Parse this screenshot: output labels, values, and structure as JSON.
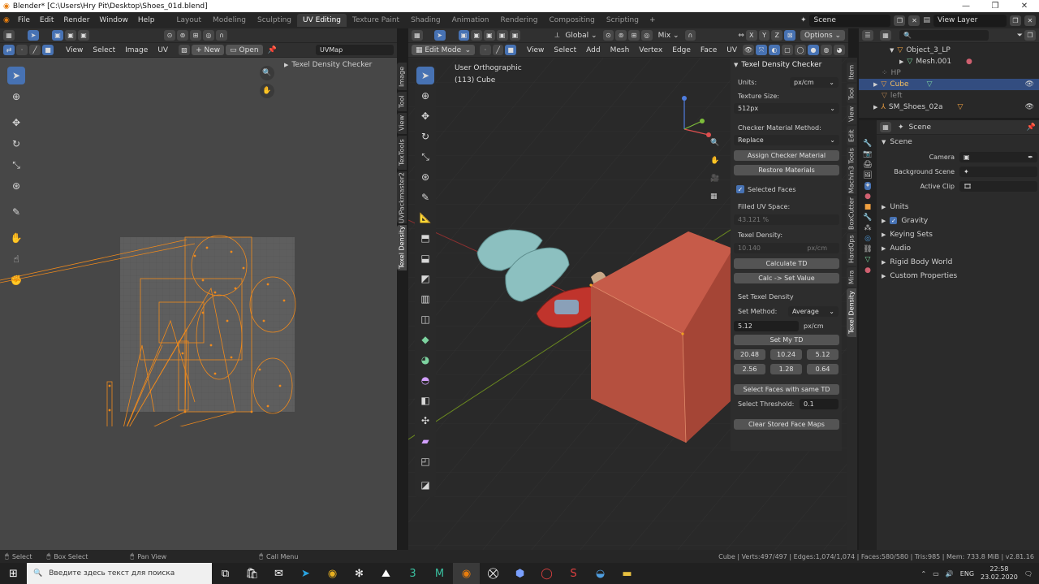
{
  "window": {
    "title": "Blender* [C:\\Users\\Hry Pit\\Desktop\\Shoes_01d.blend]"
  },
  "menu": [
    "File",
    "Edit",
    "Render",
    "Window",
    "Help"
  ],
  "workspaces": [
    "Layout",
    "Modeling",
    "Sculpting",
    "UV Editing",
    "Texture Paint",
    "Shading",
    "Animation",
    "Rendering",
    "Compositing",
    "Scripting"
  ],
  "active_workspace": "UV Editing",
  "scene_name": "Scene",
  "view_layer": "View Layer",
  "uv_editor": {
    "menus": [
      "View",
      "Select",
      "Image",
      "UV"
    ],
    "new_label": "New",
    "open_label": "Open",
    "uvmap": "UVMap",
    "sidebar_title": "Texel Density Checker",
    "tabs": [
      "Image",
      "Tool",
      "View",
      "TexTools",
      "UVPackmaster2",
      "Texel Density"
    ]
  },
  "viewport": {
    "mode": "Edit Mode",
    "menus": [
      "View",
      "Select",
      "Add",
      "Mesh",
      "Vertex",
      "Edge",
      "Face",
      "UV"
    ],
    "transform": "Global",
    "proportional": "Mix",
    "axes": [
      "X",
      "Y",
      "Z"
    ],
    "options_label": "Options",
    "view_name": "User Orthographic",
    "object_info": "(113) Cube",
    "tabs": [
      "Item",
      "Tool",
      "View",
      "Edit",
      "Machin3 Tools",
      "BoxCutter",
      "HardOps",
      "Mira",
      "Texel Density"
    ]
  },
  "td_panel": {
    "title": "Texel Density Checker",
    "units_label": "Units:",
    "units_value": "px/cm",
    "texture_size_label": "Texture Size:",
    "texture_size_value": "512px",
    "checker_method_label": "Checker Material Method:",
    "checker_method_value": "Replace",
    "assign_btn": "Assign Checker Material",
    "restore_btn": "Restore Materials",
    "selected_faces_label": "Selected Faces",
    "selected_faces_checked": true,
    "filled_uv_label": "Filled UV Space:",
    "filled_uv_value": "43.121 %",
    "texel_density_label": "Texel Density:",
    "texel_density_value": "10.140",
    "texel_density_unit": "px/cm",
    "calc_btn": "Calculate TD",
    "calc_set_btn": "Calc -> Set Value",
    "set_td_title": "Set Texel Density",
    "set_method_label": "Set Method:",
    "set_method_value": "Average",
    "set_value": "5.12",
    "set_unit": "px/cm",
    "set_my_td_btn": "Set My TD",
    "presets": [
      "20.48",
      "10.24",
      "5.12",
      "2.56",
      "1.28",
      "0.64"
    ],
    "select_same_btn": "Select Faces with same TD",
    "threshold_label": "Select Threshold:",
    "threshold_value": "0.1",
    "clear_btn": "Clear Stored Face Maps"
  },
  "outliner": {
    "items": [
      {
        "name": "Object_3_LP",
        "indent": 2
      },
      {
        "name": "Mesh.001",
        "indent": 3
      },
      {
        "name": "HP",
        "indent": 1
      },
      {
        "name": "Cube",
        "indent": 1,
        "selected": true
      },
      {
        "name": "left",
        "indent": 1
      },
      {
        "name": "SM_Shoes_02a",
        "indent": 1
      }
    ]
  },
  "properties": {
    "scene_label": "Scene",
    "section": "Scene",
    "camera_label": "Camera",
    "background_label": "Background Scene",
    "active_clip_label": "Active Clip",
    "subsections": [
      "Units",
      "Gravity",
      "Keying Sets",
      "Audio",
      "Rigid Body World",
      "Custom Properties"
    ]
  },
  "statusbar": {
    "select": "Select",
    "box_select": "Box Select",
    "pan_view": "Pan View",
    "call_menu": "Call Menu",
    "stats": "Cube | Verts:497/497 | Edges:1,074/1,074 | Faces:580/580 | Tris:985 | Mem: 733.8 MiB | v2.81.16"
  },
  "taskbar": {
    "search_placeholder": "Введите здесь текст для поиска",
    "lang": "ENG",
    "time": "22:58",
    "date": "23.02.2020"
  },
  "colors": {
    "accent": "#4772b3",
    "uv_orange": "#f08a1c",
    "cube": "#b5503f",
    "shoe": "#8cc0c0"
  }
}
